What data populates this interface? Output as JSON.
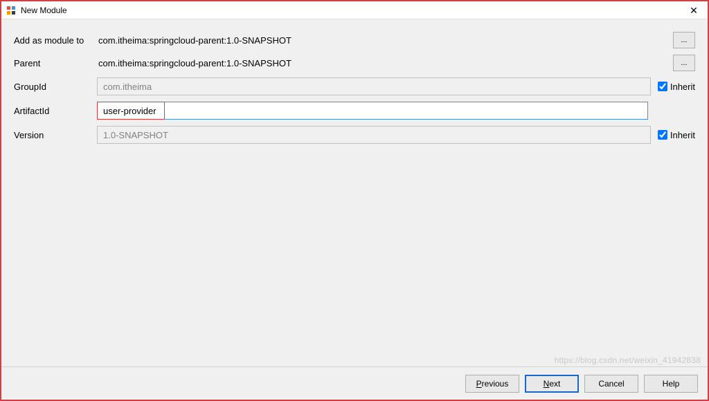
{
  "titlebar": {
    "title": "New Module",
    "close_symbol": "✕"
  },
  "form": {
    "add_as_module_label": "Add as module to",
    "add_as_module_value": "com.itheima:springcloud-parent:1.0-SNAPSHOT",
    "parent_label": "Parent",
    "parent_value": "com.itheima:springcloud-parent:1.0-SNAPSHOT",
    "groupid_label": "GroupId",
    "groupid_value": "com.itheima",
    "artifactid_label": "ArtifactId",
    "artifactid_value": "user-provider",
    "version_label": "Version",
    "version_value": "1.0-SNAPSHOT",
    "inherit_label": "Inherit",
    "browse_label": "..."
  },
  "footer": {
    "previous_label": "Previous",
    "previous_accel": "P",
    "next_label": "Next",
    "next_accel": "N",
    "cancel_label": "Cancel",
    "help_label": "Help"
  },
  "watermark": "https://blog.csdn.net/weixin_41942838"
}
